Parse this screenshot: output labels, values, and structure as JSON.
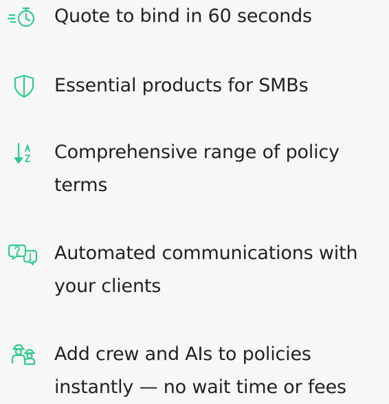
{
  "accent_color": "#2ecc8a",
  "features": [
    {
      "icon": "stopwatch-icon",
      "text": "Quote to bind in 60 seconds"
    },
    {
      "icon": "shield-icon",
      "text": "Essential products for SMBs"
    },
    {
      "icon": "sort-a-z-icon",
      "text": "Comprehensive range of policy terms"
    },
    {
      "icon": "chat-question-icon",
      "text": "Automated communications with your clients"
    },
    {
      "icon": "crew-people-icon",
      "text": "Add crew and AIs to policies instantly — no wait time or fees"
    }
  ]
}
